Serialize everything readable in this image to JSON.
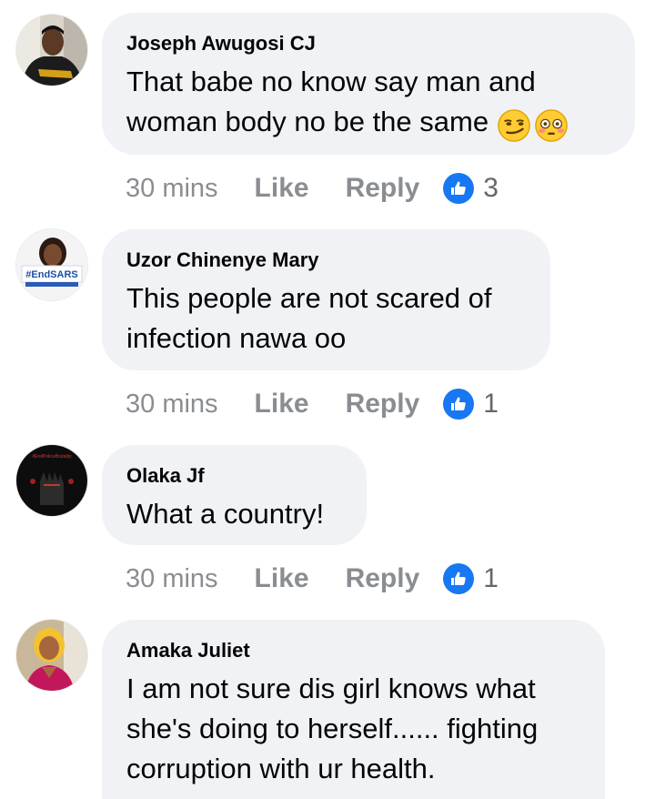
{
  "theme": {
    "bubble_bg": "#f0f2f5",
    "meta_gray": "#8a8d91",
    "like_blue": "#1877f2"
  },
  "comments": [
    {
      "author": "Joseph Awugosi CJ",
      "text": "That babe no know say man and woman body no be the same",
      "emojis": [
        "smirk-emoji",
        "flushed-emoji"
      ],
      "time": "30 mins",
      "like_label": "Like",
      "reply_label": "Reply",
      "reaction_icon": "thumbs-up-icon",
      "reaction_count": "3"
    },
    {
      "author": "Uzor Chinenye Mary",
      "avatar_text": "#EndSARS",
      "text": "This people are not scared of infection nawa oo",
      "time": "30 mins",
      "like_label": "Like",
      "reply_label": "Reply",
      "reaction_icon": "thumbs-up-icon",
      "reaction_count": "1"
    },
    {
      "author": "Olaka Jf",
      "avatar_text": "#EndPoliceBrutality",
      "text": "What a country!",
      "time": "30 mins",
      "like_label": "Like",
      "reply_label": "Reply",
      "reaction_icon": "thumbs-up-icon",
      "reaction_count": "1"
    },
    {
      "author": "Amaka Juliet",
      "text": "I am not sure dis girl knows what she's doing to herself...... fighting corruption with ur health."
    }
  ]
}
